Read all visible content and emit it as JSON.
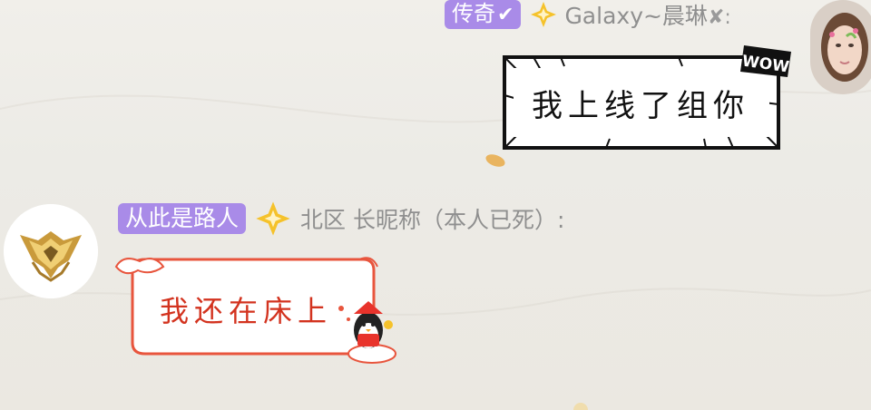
{
  "messages": [
    {
      "side": "right",
      "badge": "传奇",
      "badge_check": "✔",
      "sender": "Galaxy~晨琳",
      "sender_suffix": "✘:",
      "text": "我上线了组你",
      "bubble_style": "wow-comic",
      "sticker_text": "WOW"
    },
    {
      "side": "left",
      "badge": "从此是路人",
      "sender": "北区 长昵称（本人已死）:",
      "text": "我还在床上",
      "bubble_style": "new-year-cloud"
    }
  ],
  "colors": {
    "badge_purple": "#a98be8",
    "diamond_gold": "#f5c22b",
    "bubble_red_border": "#e8553d",
    "bubble_red_text": "#d3331f",
    "name_gray": "#8f8f8f"
  },
  "icons": [
    "diamond-rank-icon",
    "checkmark-icon",
    "cross-icon",
    "wow-sticker-icon",
    "rank-emblem-icon"
  ]
}
